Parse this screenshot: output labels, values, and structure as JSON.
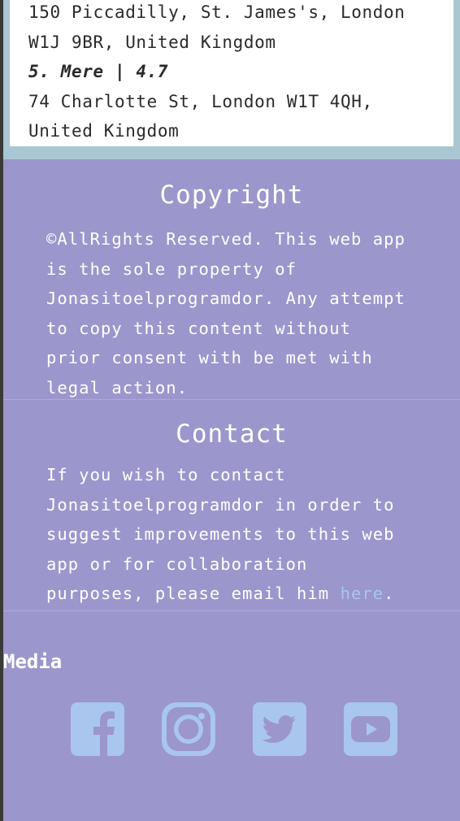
{
  "restaurants": {
    "prev_address": [
      "150 Piccadilly, St. James's, London",
      "W1J 9BR, United Kingdom"
    ],
    "item": {
      "title": "5. Mere | 4.7",
      "address": [
        "74 Charlotte St, London W1T 4QH,",
        "United Kingdom"
      ]
    }
  },
  "footer": {
    "copyright": {
      "heading": "Copyright",
      "lines": [
        "©AllRights Reserved. This web app",
        "is the sole property of",
        "Jonasitoelprogramdor. Any attempt",
        "to copy this content without",
        "prior consent with be met with",
        "legal action."
      ]
    },
    "contact": {
      "heading": "Contact",
      "lines": [
        "If you wish to contact",
        "Jonasitoelprogramdor in order to",
        "suggest improvements to this web",
        "app or for collaboration"
      ],
      "last_line_prefix": "purposes, please email him ",
      "link_text": "here",
      "last_line_suffix": "."
    },
    "media": {
      "heading": "Media",
      "icons": [
        "facebook-icon",
        "instagram-icon",
        "twitter-icon",
        "youtube-icon"
      ]
    }
  },
  "colors": {
    "footer_bg": "#9b96cc",
    "page_bg": "#a9c6d3",
    "link": "#a9c6ee",
    "icon": "#a9c6ee"
  }
}
